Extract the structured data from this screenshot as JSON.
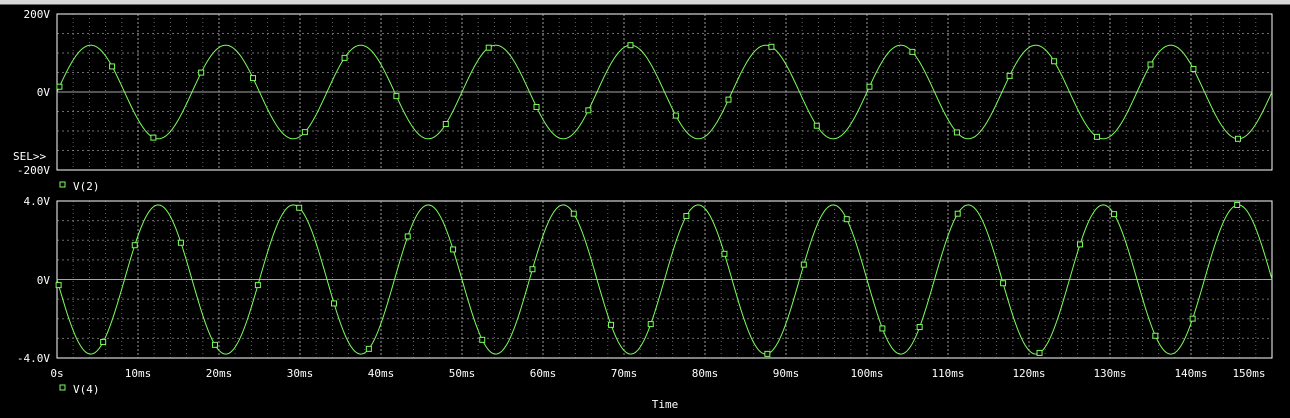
{
  "window": {
    "x_axis_label": "Time",
    "selector_marker": "SEL>>"
  },
  "colors": {
    "background": "#000000",
    "frame": "#ffffff",
    "grid": "#b8b8b8",
    "trace": "#7cff5c",
    "text": "#ffffff"
  },
  "chart_data": [
    {
      "type": "line",
      "x_unit": "ms",
      "xlim": [
        0,
        150
      ],
      "x_ticks": [
        0,
        10,
        20,
        30,
        40,
        50,
        60,
        70,
        80,
        90,
        100,
        110,
        120,
        130,
        140,
        150
      ],
      "x_tick_labels": [
        "0s",
        "10ms",
        "20ms",
        "30ms",
        "40ms",
        "50ms",
        "60ms",
        "70ms",
        "80ms",
        "90ms",
        "100ms",
        "110ms",
        "120ms",
        "130ms",
        "140ms",
        "150ms"
      ],
      "ylim": [
        -200,
        200
      ],
      "y_unit": "V",
      "y_ticks": [
        200,
        0,
        -200
      ],
      "y_tick_labels": [
        "200V",
        "0V",
        "-200V"
      ],
      "grid": true,
      "selected": true,
      "series": [
        {
          "name": "V(2)",
          "waveform": "sine",
          "amplitude": 120,
          "frequency_hz": 60,
          "phase_deg": 0,
          "marker": "square",
          "marker_times_ms": [
            0.3,
            6.8,
            11.9,
            17.8,
            24.2,
            30.6,
            35.5,
            41.9,
            48.0,
            53.3,
            59.2,
            65.6,
            70.8,
            76.4,
            82.9,
            88.2,
            93.8,
            100.3,
            105.6,
            111.1,
            117.6,
            123.1,
            128.4,
            135.0,
            140.3,
            145.8
          ]
        }
      ]
    },
    {
      "type": "line",
      "x_unit": "ms",
      "xlim": [
        0,
        150
      ],
      "x_ticks": [
        0,
        10,
        20,
        30,
        40,
        50,
        60,
        70,
        80,
        90,
        100,
        110,
        120,
        130,
        140,
        150
      ],
      "x_tick_labels": [
        "0s",
        "10ms",
        "20ms",
        "30ms",
        "40ms",
        "50ms",
        "60ms",
        "70ms",
        "80ms",
        "90ms",
        "100ms",
        "110ms",
        "120ms",
        "130ms",
        "140ms",
        "150ms"
      ],
      "ylim": [
        -4,
        4
      ],
      "y_unit": "V",
      "y_ticks": [
        4,
        0,
        -4
      ],
      "y_tick_labels": [
        "4.0V",
        "0V",
        "-4.0V"
      ],
      "grid": true,
      "selected": false,
      "series": [
        {
          "name": "V(4)",
          "waveform": "sine",
          "amplitude": 3.8,
          "frequency_hz": 60,
          "phase_deg": 180,
          "marker": "square",
          "marker_times_ms": [
            0.2,
            5.7,
            9.6,
            15.3,
            19.5,
            24.8,
            29.9,
            34.2,
            38.5,
            43.3,
            48.9,
            52.5,
            58.7,
            63.8,
            68.4,
            73.3,
            77.7,
            82.4,
            87.7,
            92.2,
            97.5,
            101.9,
            106.5,
            111.2,
            116.8,
            121.3,
            126.3,
            130.5,
            135.6,
            140.2,
            145.7
          ]
        }
      ]
    }
  ]
}
